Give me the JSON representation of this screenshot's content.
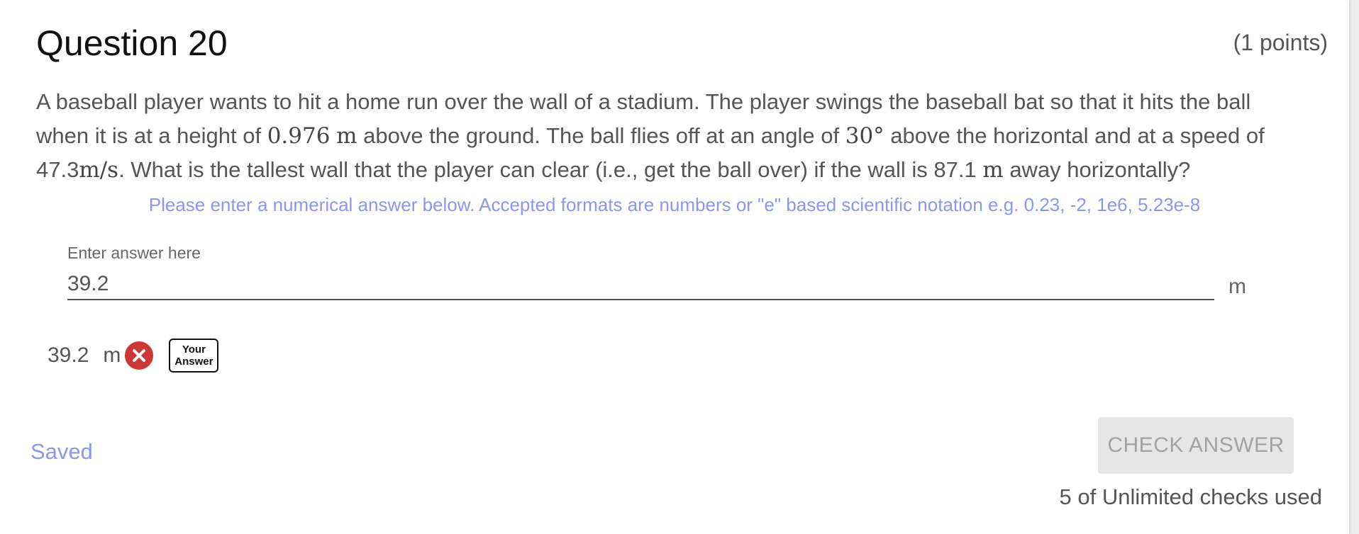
{
  "question": {
    "title": "Question 20",
    "points": "(1 points)",
    "text": {
      "l1": "A baseball player wants to hit a home run over the wall of a stadium. The player swings the baseball bat so that it hits the ball",
      "l2a": "when it is at a height of ",
      "l2_height_value": "0.976",
      "l2_height_unit": "m",
      "l2b": " above the ground.  The ball flies off at an angle of ",
      "l2_angle": "30°",
      "l2c": " above the horizontal and at a speed of",
      "l3_speed_value": "47.3",
      "l3_speed_unit": "m/s",
      "l3a": ". What is the tallest wall that the player can clear (i.e., get the ball over) if the wall is 87.1 ",
      "l3_dist_unit": "m",
      "l3b": " away horizontally?"
    },
    "hint": "Please enter a numerical answer below. Accepted formats are numbers or \"e\" based scientific notation e.g. 0.23, -2, 1e6, 5.23e-8"
  },
  "answer": {
    "label": "Enter answer here",
    "value": "39.2",
    "unit": "m"
  },
  "submitted": {
    "value": "39.2",
    "unit": "m",
    "status_icon": "close-icon",
    "status_color": "#cf3737",
    "badge_line1": "Your",
    "badge_line2": "Answer"
  },
  "footer": {
    "saved": "Saved",
    "check_button": "CHECK ANSWER",
    "checks_used": "5 of Unlimited checks used"
  },
  "colors": {
    "accent": "#8a96f0",
    "error": "#cf3737"
  }
}
